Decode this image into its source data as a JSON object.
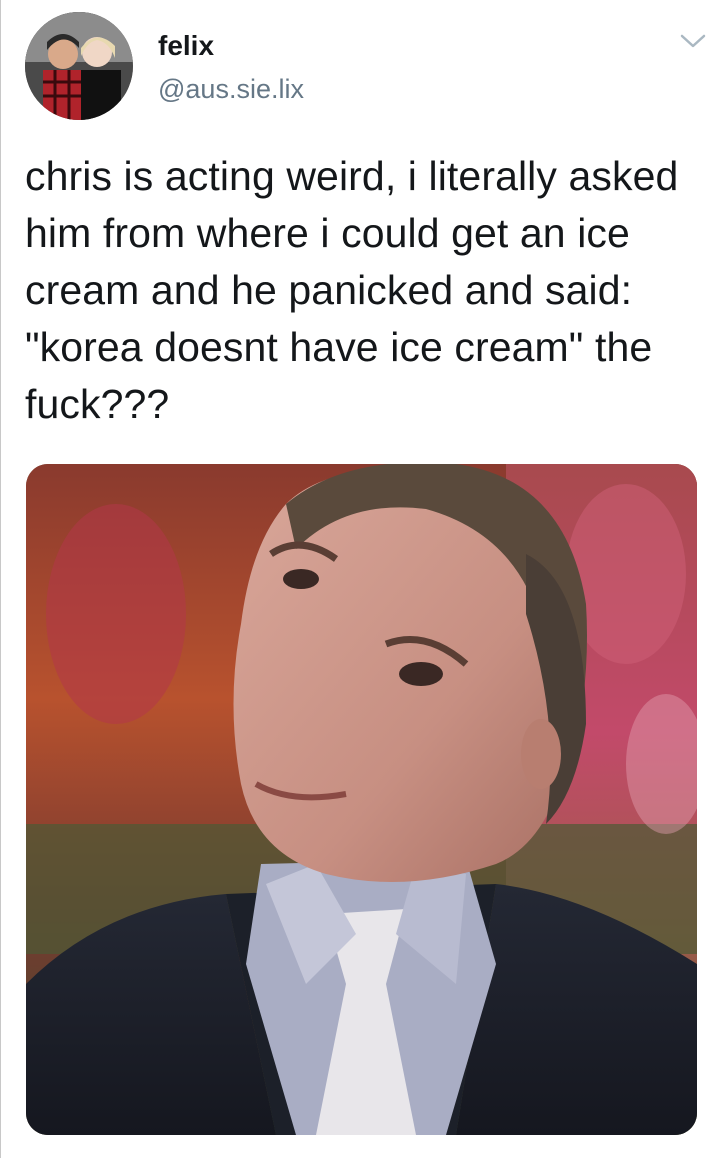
{
  "tweet": {
    "display_name": "felix",
    "handle": "@aus.sie.lix",
    "text": "chris is acting weird, i literally asked him from where i could get an ice cream and he panicked and said: \"korea doesnt have ice cream\" the fuck???"
  },
  "icons": {
    "menu": "chevron-down-icon"
  },
  "colors": {
    "name_text": "#14171a",
    "handle_text": "#657786",
    "body_text": "#14171a",
    "background": "#ffffff"
  }
}
